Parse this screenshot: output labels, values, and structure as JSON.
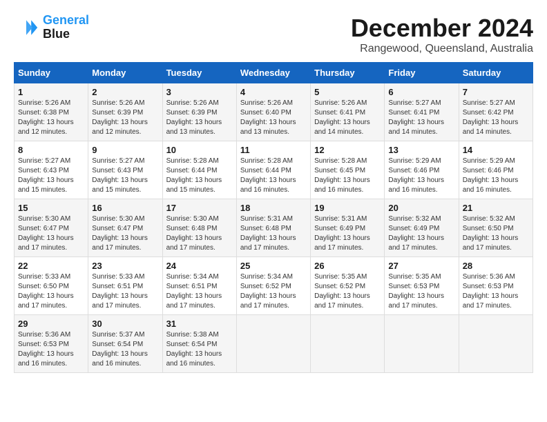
{
  "header": {
    "logo_line1": "General",
    "logo_line2": "Blue",
    "month": "December 2024",
    "location": "Rangewood, Queensland, Australia"
  },
  "weekdays": [
    "Sunday",
    "Monday",
    "Tuesday",
    "Wednesday",
    "Thursday",
    "Friday",
    "Saturday"
  ],
  "weeks": [
    [
      {
        "day": "1",
        "lines": [
          "Sunrise: 5:26 AM",
          "Sunset: 6:38 PM",
          "Daylight: 13 hours",
          "and 12 minutes."
        ]
      },
      {
        "day": "2",
        "lines": [
          "Sunrise: 5:26 AM",
          "Sunset: 6:39 PM",
          "Daylight: 13 hours",
          "and 12 minutes."
        ]
      },
      {
        "day": "3",
        "lines": [
          "Sunrise: 5:26 AM",
          "Sunset: 6:39 PM",
          "Daylight: 13 hours",
          "and 13 minutes."
        ]
      },
      {
        "day": "4",
        "lines": [
          "Sunrise: 5:26 AM",
          "Sunset: 6:40 PM",
          "Daylight: 13 hours",
          "and 13 minutes."
        ]
      },
      {
        "day": "5",
        "lines": [
          "Sunrise: 5:26 AM",
          "Sunset: 6:41 PM",
          "Daylight: 13 hours",
          "and 14 minutes."
        ]
      },
      {
        "day": "6",
        "lines": [
          "Sunrise: 5:27 AM",
          "Sunset: 6:41 PM",
          "Daylight: 13 hours",
          "and 14 minutes."
        ]
      },
      {
        "day": "7",
        "lines": [
          "Sunrise: 5:27 AM",
          "Sunset: 6:42 PM",
          "Daylight: 13 hours",
          "and 14 minutes."
        ]
      }
    ],
    [
      {
        "day": "8",
        "lines": [
          "Sunrise: 5:27 AM",
          "Sunset: 6:43 PM",
          "Daylight: 13 hours",
          "and 15 minutes."
        ]
      },
      {
        "day": "9",
        "lines": [
          "Sunrise: 5:27 AM",
          "Sunset: 6:43 PM",
          "Daylight: 13 hours",
          "and 15 minutes."
        ]
      },
      {
        "day": "10",
        "lines": [
          "Sunrise: 5:28 AM",
          "Sunset: 6:44 PM",
          "Daylight: 13 hours",
          "and 15 minutes."
        ]
      },
      {
        "day": "11",
        "lines": [
          "Sunrise: 5:28 AM",
          "Sunset: 6:44 PM",
          "Daylight: 13 hours",
          "and 16 minutes."
        ]
      },
      {
        "day": "12",
        "lines": [
          "Sunrise: 5:28 AM",
          "Sunset: 6:45 PM",
          "Daylight: 13 hours",
          "and 16 minutes."
        ]
      },
      {
        "day": "13",
        "lines": [
          "Sunrise: 5:29 AM",
          "Sunset: 6:46 PM",
          "Daylight: 13 hours",
          "and 16 minutes."
        ]
      },
      {
        "day": "14",
        "lines": [
          "Sunrise: 5:29 AM",
          "Sunset: 6:46 PM",
          "Daylight: 13 hours",
          "and 16 minutes."
        ]
      }
    ],
    [
      {
        "day": "15",
        "lines": [
          "Sunrise: 5:30 AM",
          "Sunset: 6:47 PM",
          "Daylight: 13 hours",
          "and 17 minutes."
        ]
      },
      {
        "day": "16",
        "lines": [
          "Sunrise: 5:30 AM",
          "Sunset: 6:47 PM",
          "Daylight: 13 hours",
          "and 17 minutes."
        ]
      },
      {
        "day": "17",
        "lines": [
          "Sunrise: 5:30 AM",
          "Sunset: 6:48 PM",
          "Daylight: 13 hours",
          "and 17 minutes."
        ]
      },
      {
        "day": "18",
        "lines": [
          "Sunrise: 5:31 AM",
          "Sunset: 6:48 PM",
          "Daylight: 13 hours",
          "and 17 minutes."
        ]
      },
      {
        "day": "19",
        "lines": [
          "Sunrise: 5:31 AM",
          "Sunset: 6:49 PM",
          "Daylight: 13 hours",
          "and 17 minutes."
        ]
      },
      {
        "day": "20",
        "lines": [
          "Sunrise: 5:32 AM",
          "Sunset: 6:49 PM",
          "Daylight: 13 hours",
          "and 17 minutes."
        ]
      },
      {
        "day": "21",
        "lines": [
          "Sunrise: 5:32 AM",
          "Sunset: 6:50 PM",
          "Daylight: 13 hours",
          "and 17 minutes."
        ]
      }
    ],
    [
      {
        "day": "22",
        "lines": [
          "Sunrise: 5:33 AM",
          "Sunset: 6:50 PM",
          "Daylight: 13 hours",
          "and 17 minutes."
        ]
      },
      {
        "day": "23",
        "lines": [
          "Sunrise: 5:33 AM",
          "Sunset: 6:51 PM",
          "Daylight: 13 hours",
          "and 17 minutes."
        ]
      },
      {
        "day": "24",
        "lines": [
          "Sunrise: 5:34 AM",
          "Sunset: 6:51 PM",
          "Daylight: 13 hours",
          "and 17 minutes."
        ]
      },
      {
        "day": "25",
        "lines": [
          "Sunrise: 5:34 AM",
          "Sunset: 6:52 PM",
          "Daylight: 13 hours",
          "and 17 minutes."
        ]
      },
      {
        "day": "26",
        "lines": [
          "Sunrise: 5:35 AM",
          "Sunset: 6:52 PM",
          "Daylight: 13 hours",
          "and 17 minutes."
        ]
      },
      {
        "day": "27",
        "lines": [
          "Sunrise: 5:35 AM",
          "Sunset: 6:53 PM",
          "Daylight: 13 hours",
          "and 17 minutes."
        ]
      },
      {
        "day": "28",
        "lines": [
          "Sunrise: 5:36 AM",
          "Sunset: 6:53 PM",
          "Daylight: 13 hours",
          "and 17 minutes."
        ]
      }
    ],
    [
      {
        "day": "29",
        "lines": [
          "Sunrise: 5:36 AM",
          "Sunset: 6:53 PM",
          "Daylight: 13 hours",
          "and 16 minutes."
        ]
      },
      {
        "day": "30",
        "lines": [
          "Sunrise: 5:37 AM",
          "Sunset: 6:54 PM",
          "Daylight: 13 hours",
          "and 16 minutes."
        ]
      },
      {
        "day": "31",
        "lines": [
          "Sunrise: 5:38 AM",
          "Sunset: 6:54 PM",
          "Daylight: 13 hours",
          "and 16 minutes."
        ]
      },
      null,
      null,
      null,
      null
    ]
  ]
}
